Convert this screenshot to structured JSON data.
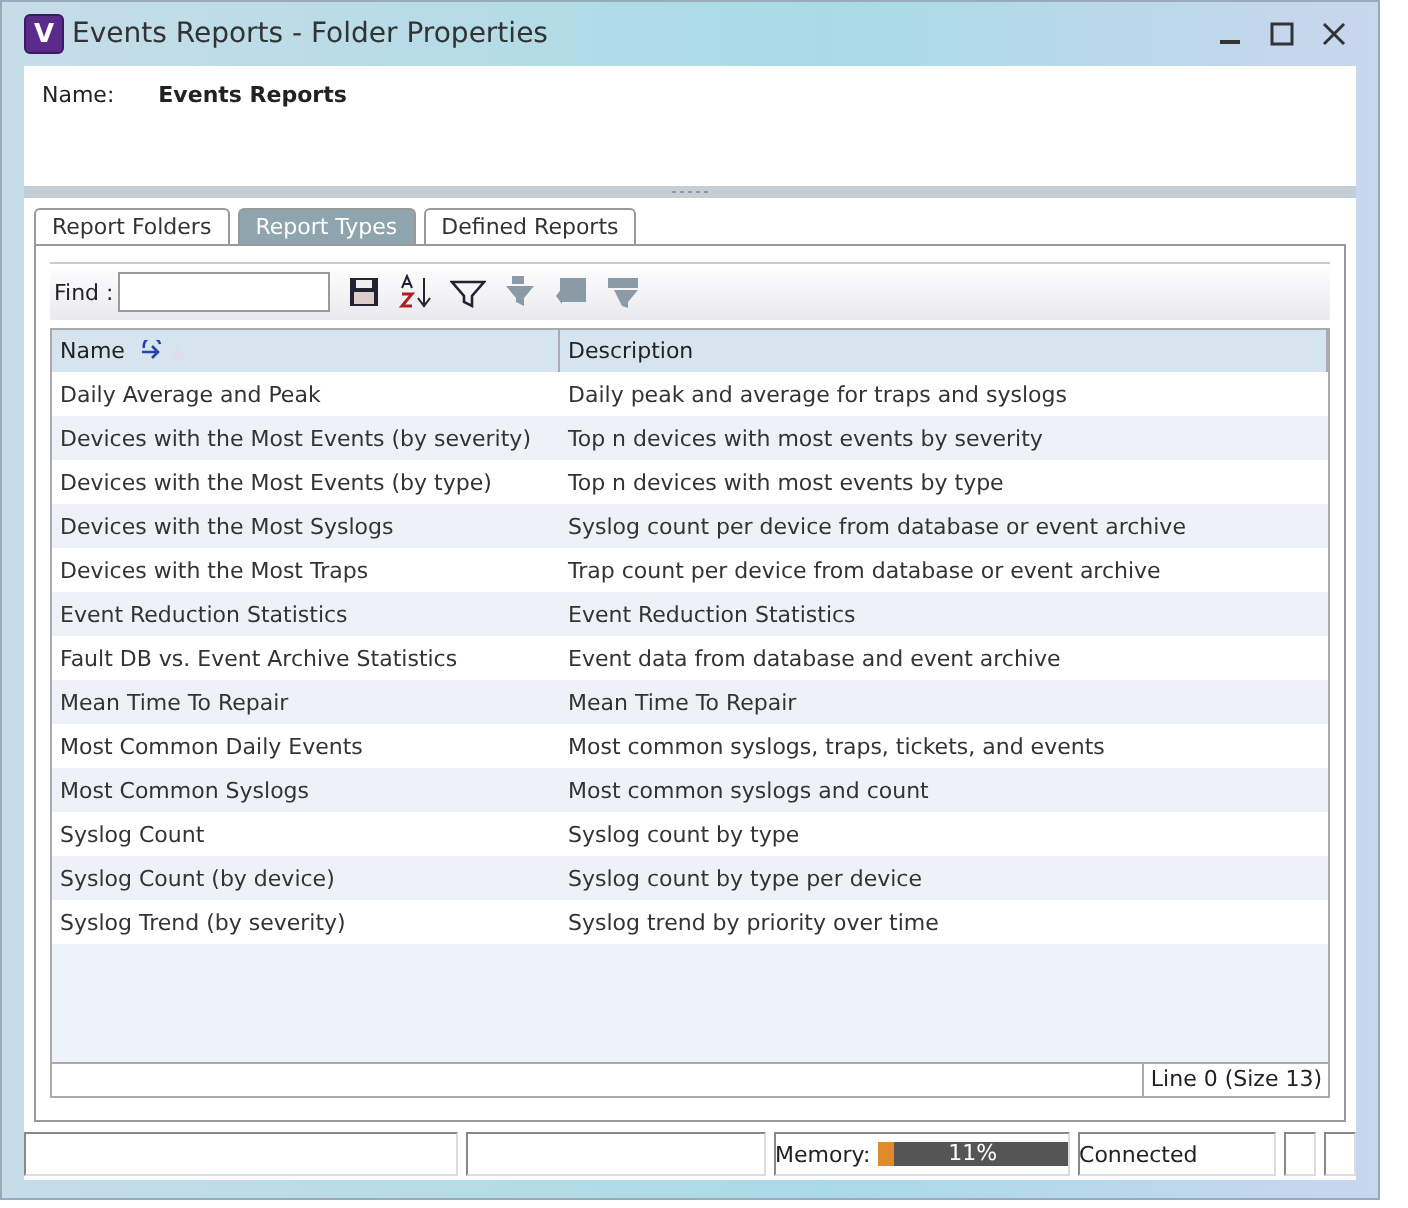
{
  "window": {
    "title": "Events Reports - Folder Properties",
    "logo": "V"
  },
  "name_field": {
    "label": "Name:",
    "value": "Events Reports"
  },
  "tabs": [
    {
      "label": "Report Folders",
      "selected": false
    },
    {
      "label": "Report Types",
      "selected": true
    },
    {
      "label": "Defined Reports",
      "selected": false
    }
  ],
  "find": {
    "label": "Find :"
  },
  "toolbar": [
    {
      "kind": "save",
      "disabled": false
    },
    {
      "kind": "sort",
      "disabled": false
    },
    {
      "kind": "filter",
      "disabled": false
    },
    {
      "kind": "clear-filter",
      "disabled": true
    },
    {
      "kind": "columns",
      "disabled": true
    },
    {
      "kind": "edit-filter",
      "disabled": true
    }
  ],
  "table": {
    "columns": [
      "Name",
      "Description"
    ],
    "rows": [
      [
        "Daily Average and Peak",
        "Daily peak and average for traps and syslogs"
      ],
      [
        "Devices with the Most Events (by severity)",
        "Top n devices with most events by severity"
      ],
      [
        "Devices with the Most Events (by type)",
        "Top n devices with most events by type"
      ],
      [
        "Devices with the Most Syslogs",
        "Syslog count per device from database or event archive"
      ],
      [
        "Devices with the Most Traps",
        "Trap count per device from database or event archive"
      ],
      [
        "Event Reduction Statistics",
        "Event Reduction Statistics"
      ],
      [
        "Fault DB vs. Event Archive Statistics",
        "Event data from database and event archive"
      ],
      [
        "Mean Time To Repair",
        "Mean Time To Repair"
      ],
      [
        "Most Common Daily Events",
        "Most common syslogs, traps, tickets, and events"
      ],
      [
        "Most Common Syslogs",
        "Most common syslogs and count"
      ],
      [
        "Syslog Count",
        "Syslog count by type"
      ],
      [
        "Syslog Count (by device)",
        "Syslog count by type per device"
      ],
      [
        "Syslog Trend (by severity)",
        "Syslog trend by priority over time"
      ]
    ],
    "footer": "Line 0 (Size 13)"
  },
  "status_bar": {
    "memory_label": "Memory:",
    "memory": {
      "level": 0.08,
      "reading": "11%"
    },
    "connection": "Connected"
  }
}
